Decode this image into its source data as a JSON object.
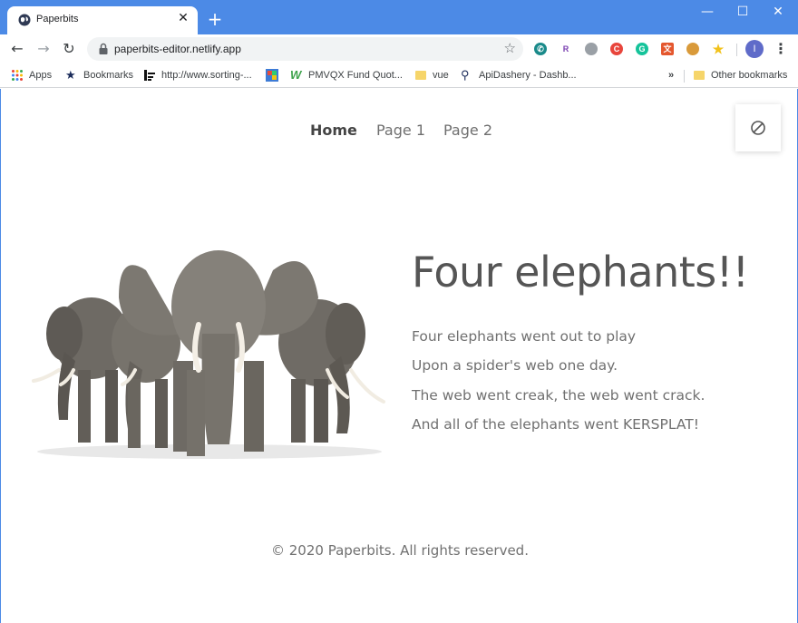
{
  "browser": {
    "tab_title": "Paperbits",
    "url": "paperbits-editor.netlify.app",
    "avatar_letter": "I",
    "accent_color": "#4c8ae6"
  },
  "bookmarks": {
    "items": [
      {
        "label": "Apps",
        "icon": "apps-grid-icon"
      },
      {
        "label": "Bookmarks",
        "icon": "star-icon"
      },
      {
        "label": "http://www.sorting-...",
        "icon": "sorting-icon"
      },
      {
        "label": "",
        "icon": "colorful-site-icon"
      },
      {
        "label": "PMVQX Fund Quot...",
        "icon": "w-logo-icon"
      },
      {
        "label": "vue",
        "icon": "folder-icon"
      },
      {
        "label": "ApiDashery - Dashb...",
        "icon": "search-icon"
      }
    ],
    "overflow": "»",
    "other": "Other bookmarks"
  },
  "site": {
    "nav": [
      {
        "label": "Home",
        "active": true
      },
      {
        "label": "Page 1",
        "active": false
      },
      {
        "label": "Page 2",
        "active": false
      }
    ],
    "heading": "Four elephants!!",
    "poem": [
      "Four elephants went out to play",
      "Upon a spider's web one day.",
      "The web went creak, the web went crack.",
      "And all of the elephants went KERSPLAT!"
    ],
    "footer": "© 2020 Paperbits. All rights reserved."
  }
}
